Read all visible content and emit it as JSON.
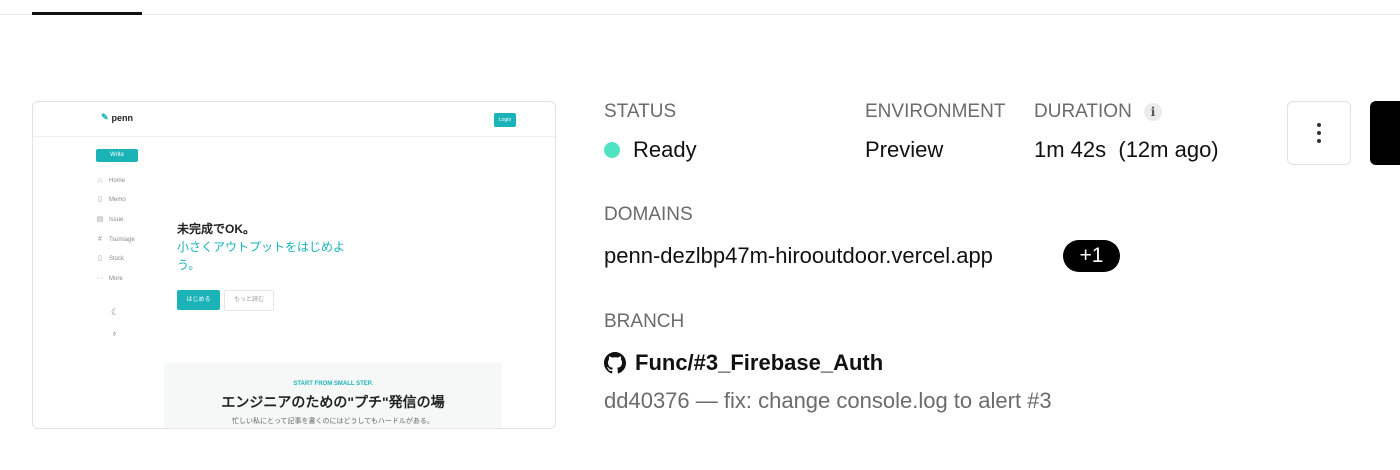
{
  "preview": {
    "logo_text": "penn",
    "login_label": "Login",
    "write_label": "Write",
    "nav_items": [
      {
        "label": "Home",
        "icon": "home-icon"
      },
      {
        "label": "Memo",
        "icon": "document-icon"
      },
      {
        "label": "Issue",
        "icon": "clipboard-icon"
      },
      {
        "label": "Tsumiage",
        "icon": "hash-icon"
      },
      {
        "label": "Stock",
        "icon": "bookmark-icon"
      },
      {
        "label": "More",
        "icon": "more-icon"
      }
    ],
    "headline": "未完成でOK。",
    "subheadline": "小さくアウトプットをはじめよう。",
    "start_button": "はじめる",
    "more_button": "もっと読む",
    "band_small": "START FROM SMALL STEP.",
    "band_title": "エンジニアのための\"プチ\"発信の場",
    "band_sub": "忙しい私にとって記事を書くのにはどうしてもハードルがある。"
  },
  "deployment": {
    "status_label": "STATUS",
    "status_value": "Ready",
    "status_color": "#50e3c2",
    "environment_label": "ENVIRONMENT",
    "environment_value": "Preview",
    "duration_label": "DURATION",
    "duration_value": "1m 42s  (12m ago)",
    "domains_label": "DOMAINS",
    "domain_value": "penn-dezlbp47m-hirooutdoor.vercel.app",
    "domain_extra_count": "+1",
    "branch_label": "BRANCH",
    "branch_value": "Func/#3_Firebase_Auth",
    "commit_value": "dd40376 — fix: change console.log to alert #3"
  }
}
